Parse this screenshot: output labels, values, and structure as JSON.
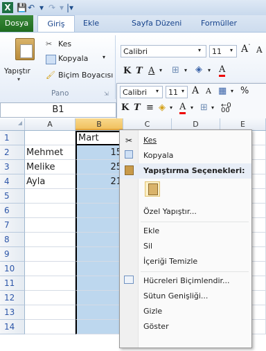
{
  "quick_access": {
    "excel_icon": "excel-logo-icon",
    "save": "save-icon",
    "undo": "undo-icon",
    "redo": "redo-icon",
    "customize": "customize-quick-access-icon"
  },
  "tabs": [
    "Dosya",
    "Giriş",
    "Ekle",
    "Sayfa Düzeni",
    "Formüller"
  ],
  "ribbon": {
    "paste_label": "Yapıştır",
    "cut_label": "Kes",
    "copy_label": "Kopyala",
    "format_painter_label": "Biçim Boyacısı",
    "clipboard_group": "Pano",
    "font_name": "Calibri",
    "font_size": "11"
  },
  "minibar": {
    "font_name": "Calibri",
    "font_size": "11"
  },
  "name_box": "B1",
  "columns": [
    "A",
    "B",
    "C",
    "D",
    "E"
  ],
  "rows": [
    "1",
    "2",
    "3",
    "4",
    "5",
    "6",
    "7",
    "8",
    "9",
    "10",
    "11",
    "12",
    "13",
    "14"
  ],
  "cells": {
    "B1": "Mart",
    "A2": "Mehmet",
    "B2": "15",
    "A3": "Melike",
    "B3": "25",
    "A4": "Ayla",
    "B4": "21"
  },
  "context_menu": {
    "cut": "Kes",
    "copy": "Kopyala",
    "paste_options_header": "Yapıştırma Seçenekleri:",
    "paste_special": "Özel Yapıştır...",
    "insert": "Ekle",
    "delete": "Sil",
    "clear_contents": "İçeriği Temizle",
    "format_cells": "Hücreleri Biçimlendir...",
    "column_width": "Sütun Genişliği...",
    "hide": "Gizle",
    "unhide": "Göster"
  },
  "colors": {
    "file_tab": "#2a7a2a",
    "selection": "#bdd7ee",
    "row_header_text": "#2d56a8"
  }
}
